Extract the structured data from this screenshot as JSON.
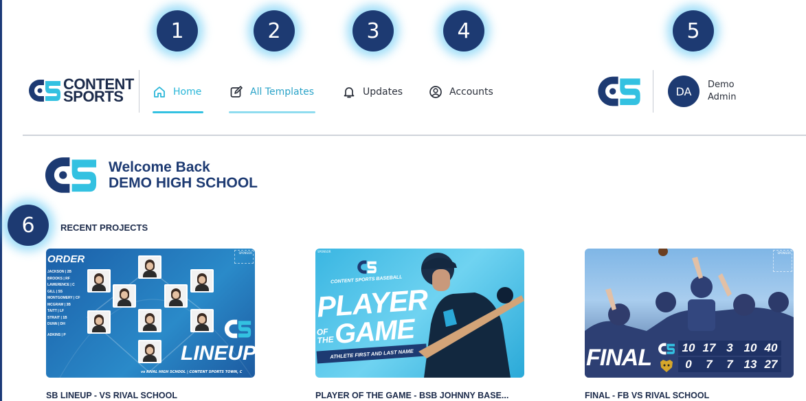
{
  "brand": {
    "line1": "CONTENT",
    "line2": "SPORTS"
  },
  "markers": [
    "1",
    "2",
    "3",
    "4",
    "5",
    "6"
  ],
  "nav": [
    {
      "label": "Home",
      "icon": "home-icon",
      "active": true
    },
    {
      "label": "All Templates",
      "icon": "edit-icon",
      "active": false
    },
    {
      "label": "Updates",
      "icon": "bell-icon",
      "active": false
    },
    {
      "label": "Accounts",
      "icon": "user-circle-icon",
      "active": false
    }
  ],
  "user": {
    "initials": "DA",
    "name_line1": "Demo",
    "name_line2": "Admin"
  },
  "welcome": {
    "line1": "Welcome Back",
    "line2": "DEMO HIGH SCHOOL"
  },
  "recent": {
    "title": "RECENT PROJECTS",
    "projects": [
      {
        "title": "SB LINEUP - VS RIVAL SCHOOL",
        "heading": "ORDER",
        "roster": [
          "JACKSON | 2B",
          "BROOKS | RF",
          "LAWERENCE | C",
          "GILL | SS",
          "MONTGOMERY | CF",
          "MCGRAW | 3B",
          "TAITT | LF",
          "STRAIT | 1B",
          "DUNN | DH",
          "ADKINS | P"
        ],
        "big_text": "LINEUP",
        "footer": "vs RIVAL HIGH SCHOOL | CONTENT SPORTS TOWN, C",
        "sponsor": "SPONSOR"
      },
      {
        "title": "PLAYER OF THE GAME - BSB JOHNNY BASE...",
        "sponsor": "SPONSOR",
        "subtitle": "CONTENT SPORTS BASEBALL",
        "big_line1": "PLAYER",
        "big_line2a": "OF",
        "big_line2b": "THE",
        "big_line2c": "GAME",
        "name_banner": "ATHLETE FIRST AND LAST NAME"
      },
      {
        "title": "FINAL - FB VS RIVAL SCHOOL",
        "sponsor": "SPONSOR",
        "big_text": "FINAL",
        "home_scores": [
          "10",
          "17",
          "3",
          "10",
          "40"
        ],
        "away_scores": [
          "0",
          "7",
          "7",
          "13",
          "27"
        ]
      }
    ]
  },
  "colors": {
    "navy": "#1d3a72",
    "accent": "#29b6d8"
  }
}
